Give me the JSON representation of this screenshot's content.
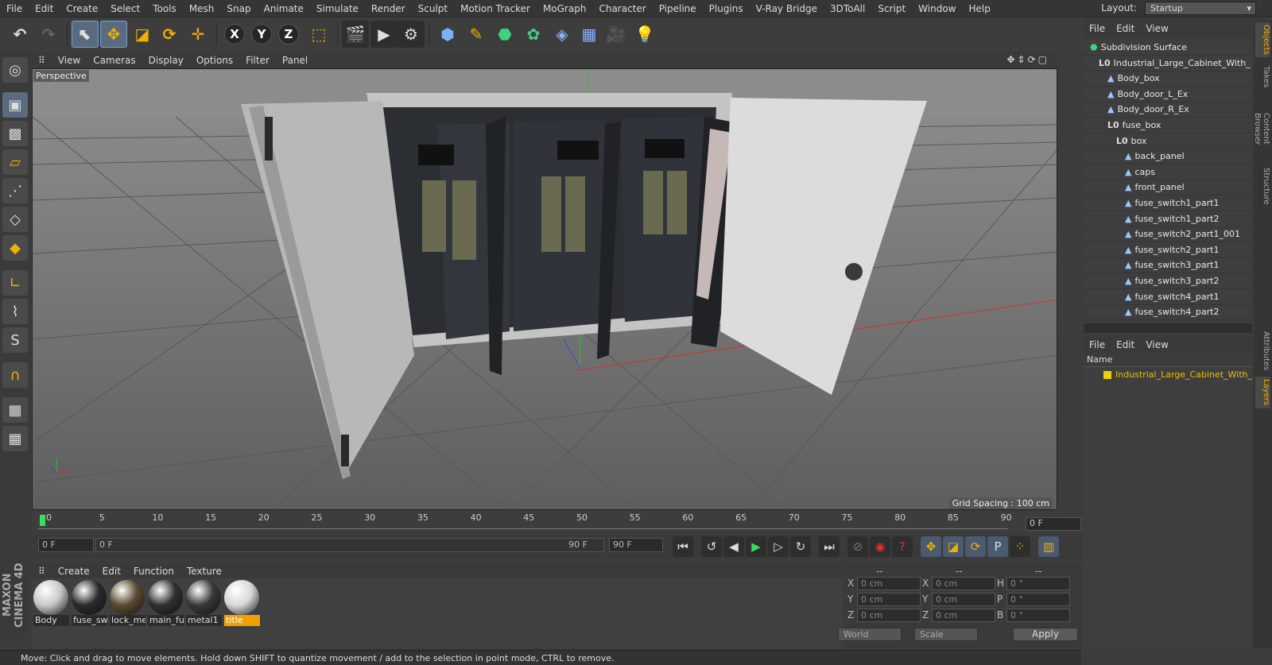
{
  "menu": [
    "File",
    "Edit",
    "Create",
    "Select",
    "Tools",
    "Mesh",
    "Snap",
    "Animate",
    "Simulate",
    "Render",
    "Sculpt",
    "Motion Tracker",
    "MoGraph",
    "Character",
    "Pipeline",
    "Plugins",
    "V-Ray Bridge",
    "3DToAll",
    "Script",
    "Window",
    "Help"
  ],
  "layout": {
    "label": "Layout:",
    "value": "Startup"
  },
  "toolbar_axes": {
    "x": "X",
    "y": "Y",
    "z": "Z"
  },
  "viewport": {
    "menu": [
      "View",
      "Cameras",
      "Display",
      "Options",
      "Filter",
      "Panel"
    ],
    "label": "Perspective",
    "grid_spacing": "Grid Spacing : 100 cm",
    "colors": {
      "bg": "#6b6b6b",
      "x_axis": "#d03030",
      "y_axis": "#30c030",
      "z_axis": "#3050d0",
      "cabinet_light": "#dcdcdc",
      "panel_dark": "#2b2e33"
    }
  },
  "timeline": {
    "ticks": [
      "0",
      "5",
      "10",
      "15",
      "20",
      "25",
      "30",
      "35",
      "40",
      "45",
      "50",
      "55",
      "60",
      "65",
      "70",
      "75",
      "80",
      "85",
      "90"
    ],
    "current": "0 F",
    "current_right": "0 F"
  },
  "transport": {
    "start": "0 F",
    "slider_left": "0 F",
    "slider_right": "90 F",
    "end": "90 F"
  },
  "materials": {
    "menu": [
      "Create",
      "Edit",
      "Function",
      "Texture"
    ],
    "items": [
      {
        "name": "Body",
        "color": "#c8c8c8",
        "selected": false
      },
      {
        "name": "fuse_sw",
        "color": "#2a2a2a",
        "selected": false
      },
      {
        "name": "lock_me",
        "color": "#5a4a30",
        "selected": false
      },
      {
        "name": "main_fu",
        "color": "#303030",
        "selected": false
      },
      {
        "name": "metal1",
        "color": "#383838",
        "selected": false
      },
      {
        "name": "title",
        "color": "#d8d8d8",
        "selected": true
      }
    ]
  },
  "coords": {
    "header": [
      "--",
      "--",
      "--"
    ],
    "rows": [
      {
        "a": "X",
        "av": "0 cm",
        "b": "X",
        "bv": "0 cm",
        "c": "H",
        "cv": "0 °"
      },
      {
        "a": "Y",
        "av": "0 cm",
        "b": "Y",
        "bv": "0 cm",
        "c": "P",
        "cv": "0 °"
      },
      {
        "a": "Z",
        "av": "0 cm",
        "b": "Z",
        "bv": "0 cm",
        "c": "B",
        "cv": "0 °"
      }
    ],
    "world": "World",
    "scale": "Scale",
    "apply": "Apply"
  },
  "status": "Move: Click and drag to move elements. Hold down SHIFT to quantize movement / add to the selection in point mode, CTRL to remove.",
  "objects": {
    "menu": [
      "File",
      "Edit",
      "View"
    ],
    "items": [
      {
        "name": "Subdivision Surface",
        "indent": 0,
        "type": "sds"
      },
      {
        "name": "Industrial_Large_Cabinet_With_",
        "indent": 1,
        "type": "null"
      },
      {
        "name": "Body_box",
        "indent": 2,
        "type": "poly"
      },
      {
        "name": "Body_door_L_Ex",
        "indent": 2,
        "type": "poly"
      },
      {
        "name": "Body_door_R_Ex",
        "indent": 2,
        "type": "poly"
      },
      {
        "name": "fuse_box",
        "indent": 2,
        "type": "null"
      },
      {
        "name": "box",
        "indent": 3,
        "type": "null"
      },
      {
        "name": "back_panel",
        "indent": 4,
        "type": "poly"
      },
      {
        "name": "caps",
        "indent": 4,
        "type": "poly"
      },
      {
        "name": "front_panel",
        "indent": 4,
        "type": "poly"
      },
      {
        "name": "fuse_switch1_part1",
        "indent": 4,
        "type": "poly"
      },
      {
        "name": "fuse_switch1_part2",
        "indent": 4,
        "type": "poly"
      },
      {
        "name": "fuse_switch2_part1_001",
        "indent": 4,
        "type": "poly"
      },
      {
        "name": "fuse_switch2_part1",
        "indent": 4,
        "type": "poly"
      },
      {
        "name": "fuse_switch3_part1",
        "indent": 4,
        "type": "poly"
      },
      {
        "name": "fuse_switch3_part2",
        "indent": 4,
        "type": "poly"
      },
      {
        "name": "fuse_switch4_part1",
        "indent": 4,
        "type": "poly"
      },
      {
        "name": "fuse_switch4_part2",
        "indent": 4,
        "type": "poly"
      }
    ]
  },
  "layers": {
    "menu": [
      "File",
      "Edit",
      "View"
    ],
    "head": "Name",
    "row": "Industrial_Large_Cabinet_With_El"
  },
  "side_tabs": [
    "Objects",
    "Takes",
    "Content Browser",
    "Structure",
    "Attributes",
    "Layers"
  ],
  "brand": "MAXON CINEMA 4D"
}
